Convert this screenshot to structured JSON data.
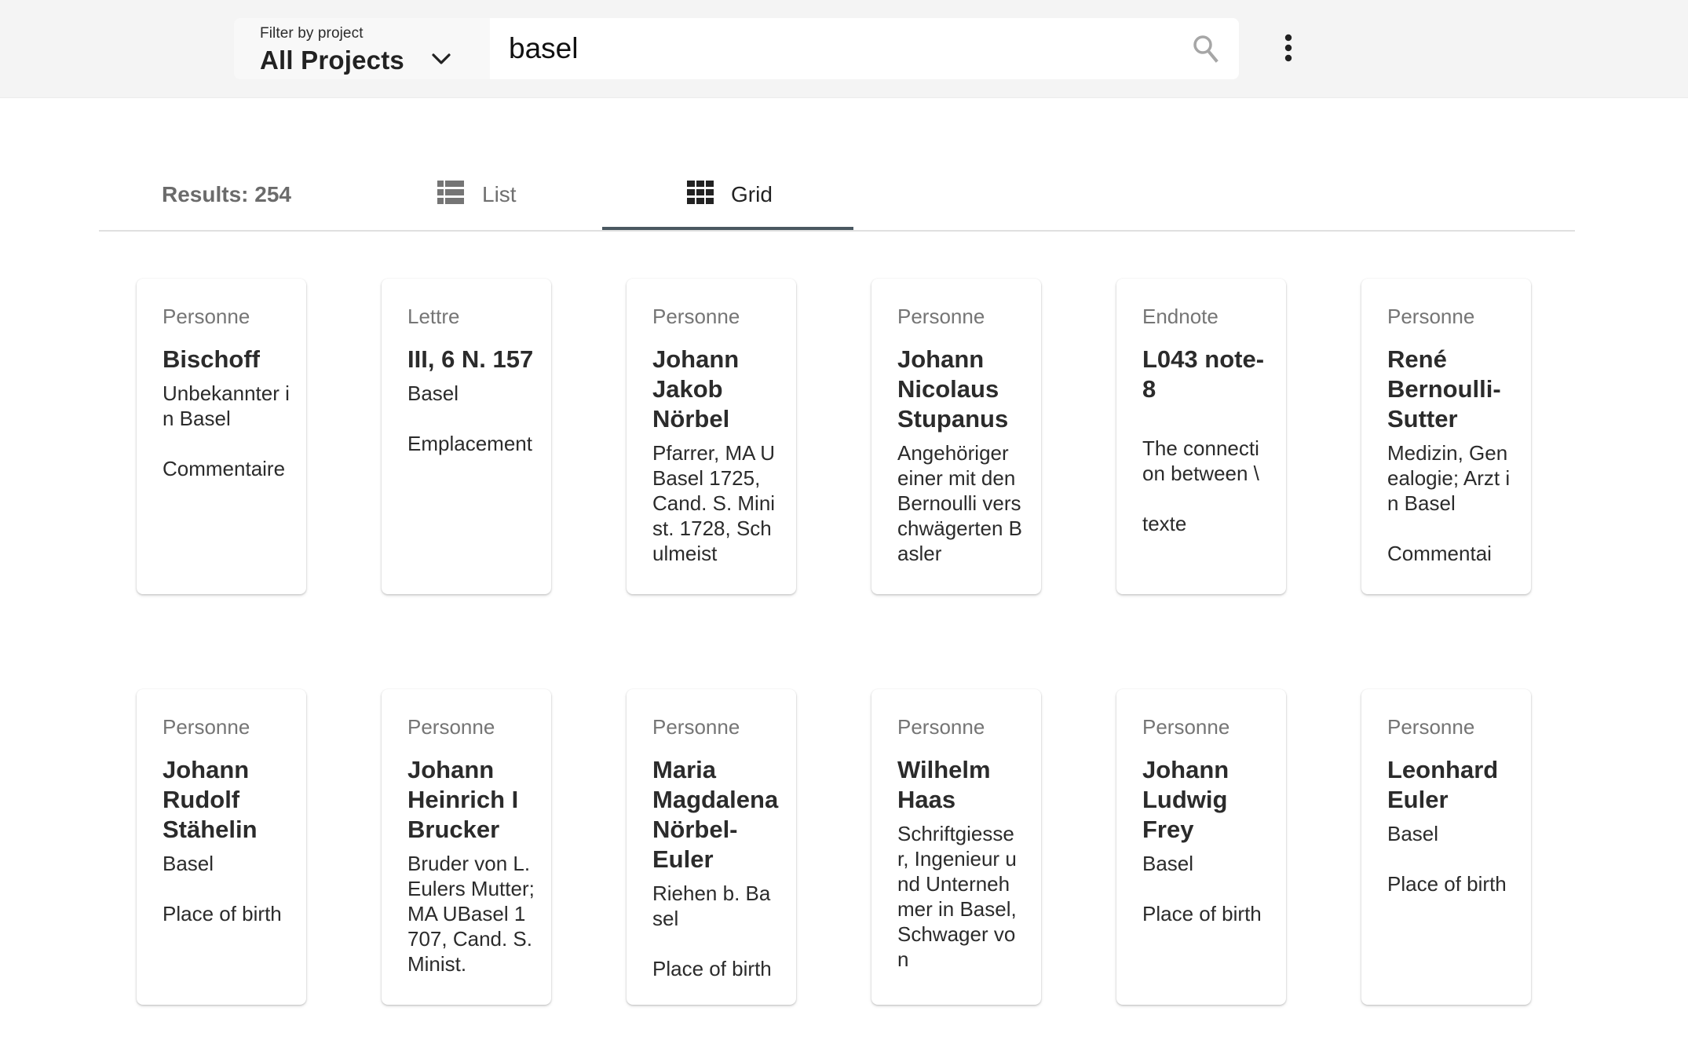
{
  "header": {
    "project_filter": {
      "label": "Filter by project",
      "selected": "All Projects"
    },
    "search": {
      "value": "basel",
      "placeholder": ""
    },
    "icons": {
      "dropdown": "chevron-down-icon",
      "search": "search-icon",
      "more": "more-vert-icon"
    }
  },
  "results_bar": {
    "results_label": "Results: 254",
    "tabs": [
      {
        "label": "List",
        "icon": "list-icon",
        "active": false
      },
      {
        "label": "Grid",
        "icon": "grid-icon",
        "active": true
      }
    ],
    "accent_color": "#4a5861"
  },
  "cards": [
    {
      "type": "Personne",
      "title": "Bischoff",
      "description": "Unbekannter in Basel\n\nCommentaire"
    },
    {
      "type": "Lettre",
      "title": "III, 6 N. 157",
      "description": "Basel\n\nEmplacement"
    },
    {
      "type": "Personne",
      "title": "Johann Jakob Nörbel",
      "description": "Pfarrer, MA UBasel 1725, Cand. S. Minist. 1728, Schulmeist"
    },
    {
      "type": "Personne",
      "title": "Johann Nicolaus Stupanus",
      "description": "Angehöriger einer mit den Bernoulli verschwägerten Basler"
    },
    {
      "type": "Endnote",
      "title": "L043 note-8",
      "description": "\nThe connection between \\\n\ntexte"
    },
    {
      "type": "Personne",
      "title": "René Bernoulli-Sutter",
      "description": "Medizin, Genealogie; Arzt in Basel\n\nCommentai"
    },
    {
      "type": "Personne",
      "title": "Johann Rudolf Stähelin",
      "description": "Basel\n\nPlace of birth"
    },
    {
      "type": "Personne",
      "title": "Johann Heinrich I Brucker",
      "description": "Bruder von L. Eulers Mutter; MA UBasel 1707, Cand. S. Minist."
    },
    {
      "type": "Personne",
      "title": "Maria Magdalena Nörbel-Euler",
      "description": "Riehen b. Basel\n\nPlace of birth"
    },
    {
      "type": "Personne",
      "title": "Wilhelm Haas",
      "description": "Schriftgiesser, Ingenieur und Unternehmer in Basel, Schwager von"
    },
    {
      "type": "Personne",
      "title": "Johann Ludwig Frey",
      "description": "Basel\n\nPlace of birth"
    },
    {
      "type": "Personne",
      "title": "Leonhard Euler",
      "description": "Basel\n\nPlace of birth"
    }
  ]
}
